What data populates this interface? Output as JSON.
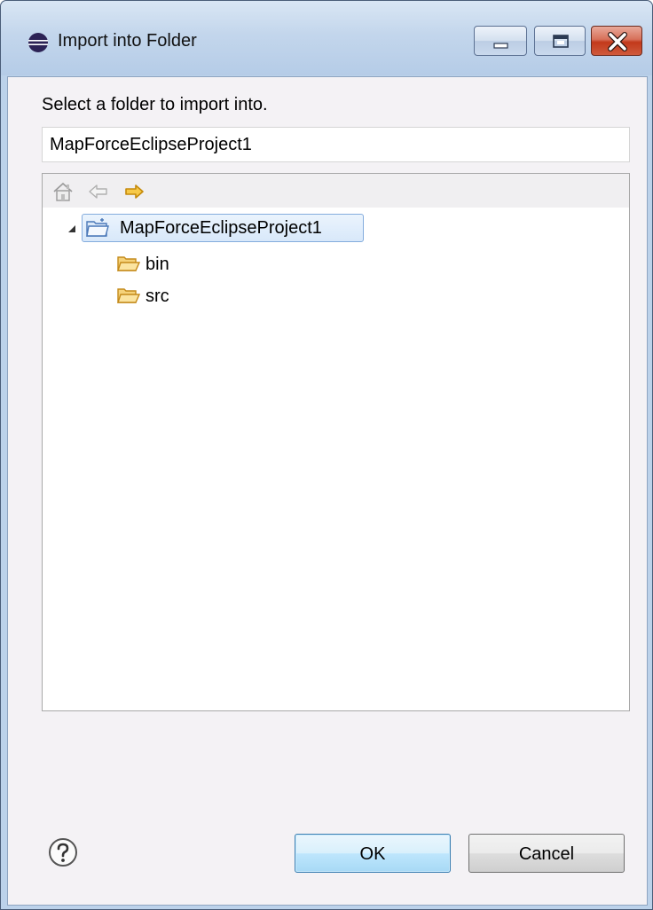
{
  "window": {
    "title": "Import into Folder",
    "icon": "eclipse-icon"
  },
  "caption_buttons": [
    "minimize-icon",
    "maximize-icon",
    "close-icon"
  ],
  "dialog": {
    "prompt": "Select a folder to import into.",
    "path_value": "MapForceEclipseProject1"
  },
  "toolbar": {
    "icons": [
      "home-icon",
      "back-arrow-icon",
      "forward-arrow-icon"
    ]
  },
  "tree": {
    "root": {
      "label": "MapForceEclipseProject1",
      "expanded": true,
      "selected": true
    },
    "children": [
      {
        "label": "bin"
      },
      {
        "label": "src"
      }
    ]
  },
  "buttons": {
    "ok": "OK",
    "cancel": "Cancel",
    "help_icon": "help-icon"
  },
  "colors": {
    "selection_border": "#84acdd",
    "folder": "#e8b64a",
    "forward_arrow": "#f2b81e"
  }
}
